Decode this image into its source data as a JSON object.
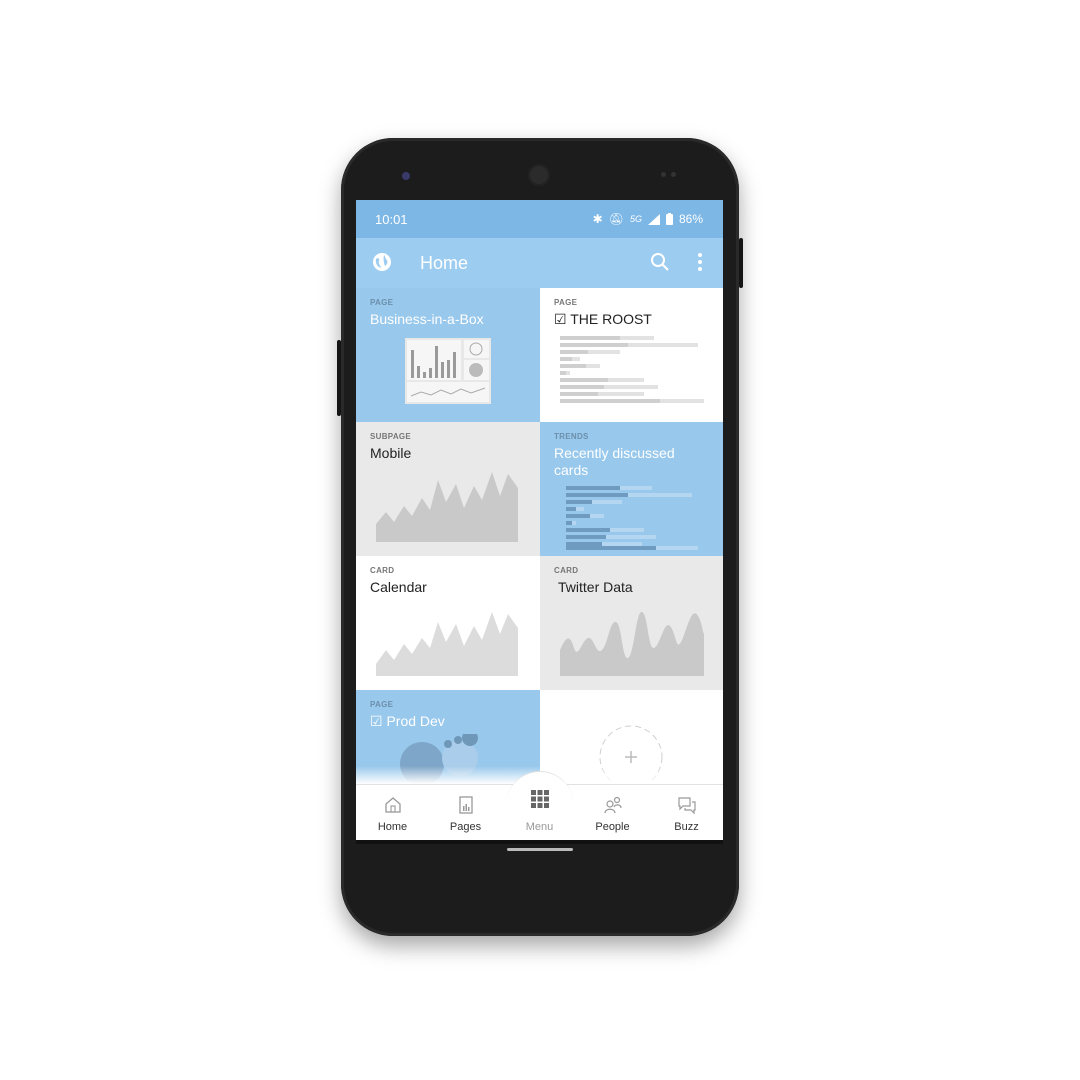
{
  "status_bar": {
    "time": "10:01",
    "network": "5G",
    "battery": "86%"
  },
  "app_bar": {
    "title": "Home",
    "left_icon": "globe-icon",
    "right_icons": [
      "search-icon",
      "more-vert-icon"
    ]
  },
  "tiles": [
    {
      "kind": "PAGE",
      "name": "Business-in-a-Box",
      "style": "blue",
      "thumb": "dashboard"
    },
    {
      "kind": "PAGE",
      "name": "☑ THE ROOST",
      "style": "white",
      "thumb": "lines"
    },
    {
      "kind": "SUBPAGE",
      "name": "Mobile",
      "style": "grey",
      "thumb": "area-chart"
    },
    {
      "kind": "TRENDS",
      "name": "Recently discussed cards",
      "style": "blue",
      "thumb": "bars"
    },
    {
      "kind": "CARD",
      "name": "Calendar",
      "style": "white",
      "thumb": "area-chart"
    },
    {
      "kind": "CARD",
      "name": "Twitter Data",
      "style": "grey",
      "thumb": "wave-chart"
    },
    {
      "kind": "PAGE",
      "name": "☑ Prod Dev",
      "style": "blue",
      "thumb": "bubbles"
    },
    {
      "kind": "",
      "name": "",
      "style": "white",
      "thumb": "add"
    }
  ],
  "bottom_nav": [
    {
      "label": "Home",
      "icon": "home-icon"
    },
    {
      "label": "Pages",
      "icon": "pages-icon"
    },
    {
      "label": "Menu",
      "icon": "grid-menu-icon"
    },
    {
      "label": "People",
      "icon": "people-icon"
    },
    {
      "label": "Buzz",
      "icon": "chat-icon"
    }
  ],
  "colors": {
    "accent": "#98c8ec",
    "status_bar": "#7db7e6",
    "app_bar": "#9cccf0",
    "tile_grey": "#e9e9e9"
  }
}
